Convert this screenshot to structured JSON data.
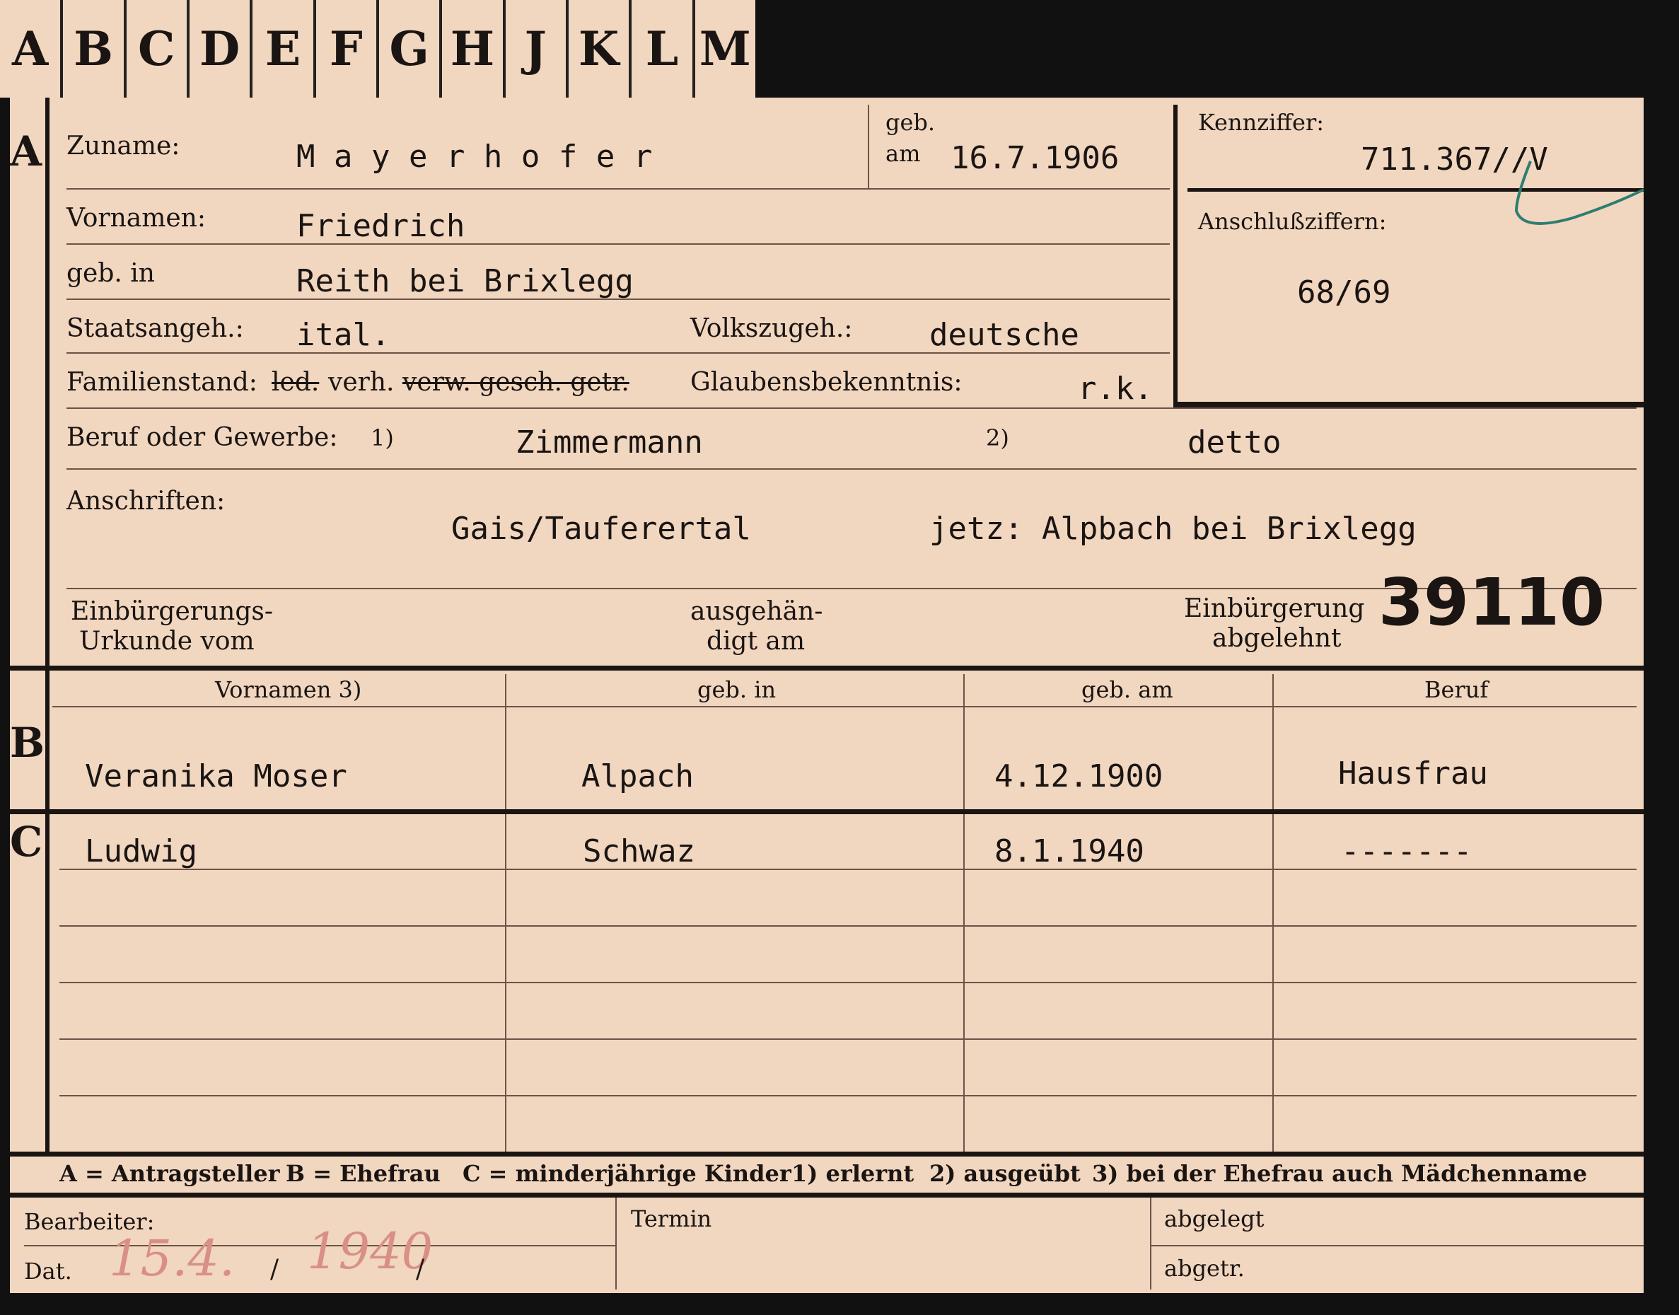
{
  "tabs": [
    "A",
    "B",
    "C",
    "D",
    "E",
    "F",
    "G",
    "H",
    "J",
    "K",
    "L",
    "M"
  ],
  "sections": {
    "a": "A",
    "b": "B",
    "c": "C"
  },
  "applicant": {
    "surname_label": "Zuname:",
    "surname": "M a y e r h o f e r",
    "born_label_1": "geb.",
    "born_label_2": "am",
    "born_date": "16.7.1906",
    "id_label": "Kennziffer:",
    "id_value": "711.367//V",
    "connect_label": "Anschlußziffern:",
    "connect_value": "68/69",
    "firstnames_label": "Vornamen:",
    "firstnames": "Friedrich",
    "birthplace_label": "geb. in",
    "birthplace": "Reith bei Brixlegg",
    "citizenship_label": "Staatsangeh.:",
    "citizenship": "ital.",
    "ethnicity_label": "Volkszugeh.:",
    "ethnicity": "deutsche",
    "marital_label": "Familienstand:",
    "marital_led": "led.",
    "marital_verh": "verh.",
    "marital_rest": "verw. gesch. getr.",
    "religion_label": "Glaubensbekenntnis:",
    "religion": "r.k.",
    "occupation_label": "Beruf oder Gewerbe:",
    "occ_mark_1": "1)",
    "occupation_learned": "Zimmermann",
    "occ_mark_2": "2)",
    "occupation_practiced": "detto",
    "address_label": "Anschriften:",
    "address_1": "Gais/Tauferertal",
    "address_2": "jetz: Alpbach bei Brixlegg",
    "naturalization_label_1": "Einbürgerungs-",
    "naturalization_label_2": "Urkunde vom",
    "handed_label_1": "ausgehän-",
    "handed_label_2": "digt am",
    "rejected_label_1": "Einbürgerung",
    "rejected_label_2": "abgelehnt",
    "stamp_number": "39110"
  },
  "family_headers": {
    "firstnames": "Vornamen 3)",
    "birthplace": "geb. in",
    "birthdate": "geb. am",
    "occupation": "Beruf"
  },
  "wife": {
    "name": "Veranika Moser",
    "birthplace": "Alpach",
    "birthdate": "4.12.1900",
    "occupation": "Hausfrau"
  },
  "children": [
    {
      "name": "Ludwig",
      "birthplace": "Schwaz",
      "birthdate": "8.1.1940",
      "occupation": "-------"
    }
  ],
  "legend": {
    "a": "A = Antragsteller",
    "b": "B = Ehefrau",
    "c": "C = minderjährige Kinder",
    "n1": "1) erlernt",
    "n2": "2) ausgeübt",
    "n3": "3) bei der Ehefrau auch Mädchenname"
  },
  "footer": {
    "clerk_label": "Bearbeiter:",
    "date_label": "Dat.",
    "date_day": "15.4.",
    "date_year": "1940",
    "deadline_label": "Termin",
    "filed_label": "abgelegt",
    "detached_label": "abgetr."
  }
}
